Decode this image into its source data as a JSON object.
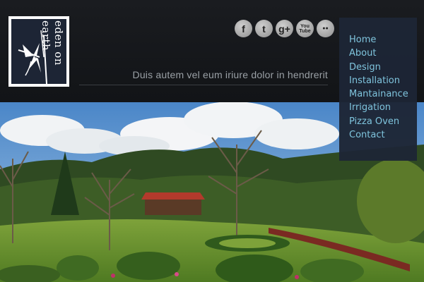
{
  "logo": {
    "text": "eden on earth",
    "icon": "dragonfly-bamboo-icon"
  },
  "social": [
    {
      "icon": "facebook-icon",
      "glyph": "f"
    },
    {
      "icon": "twitter-icon",
      "glyph": "t"
    },
    {
      "icon": "google-plus-icon",
      "glyph": "g+"
    },
    {
      "icon": "youtube-icon",
      "glyph": "You Tube"
    },
    {
      "icon": "flickr-icon",
      "glyph": "●●"
    }
  ],
  "tagline": "Duis autem vel eum iriure  dolor in hendrerit",
  "nav": {
    "items": [
      "Home",
      "About",
      "Design",
      "Installation",
      "Mantainance",
      "Irrigation",
      "Pizza Oven",
      "Contact"
    ]
  },
  "colors": {
    "nav_bg": "#1d2535",
    "nav_text": "#7fc4dd",
    "header_bg": "#141619",
    "tagline": "#9aa0a6"
  }
}
